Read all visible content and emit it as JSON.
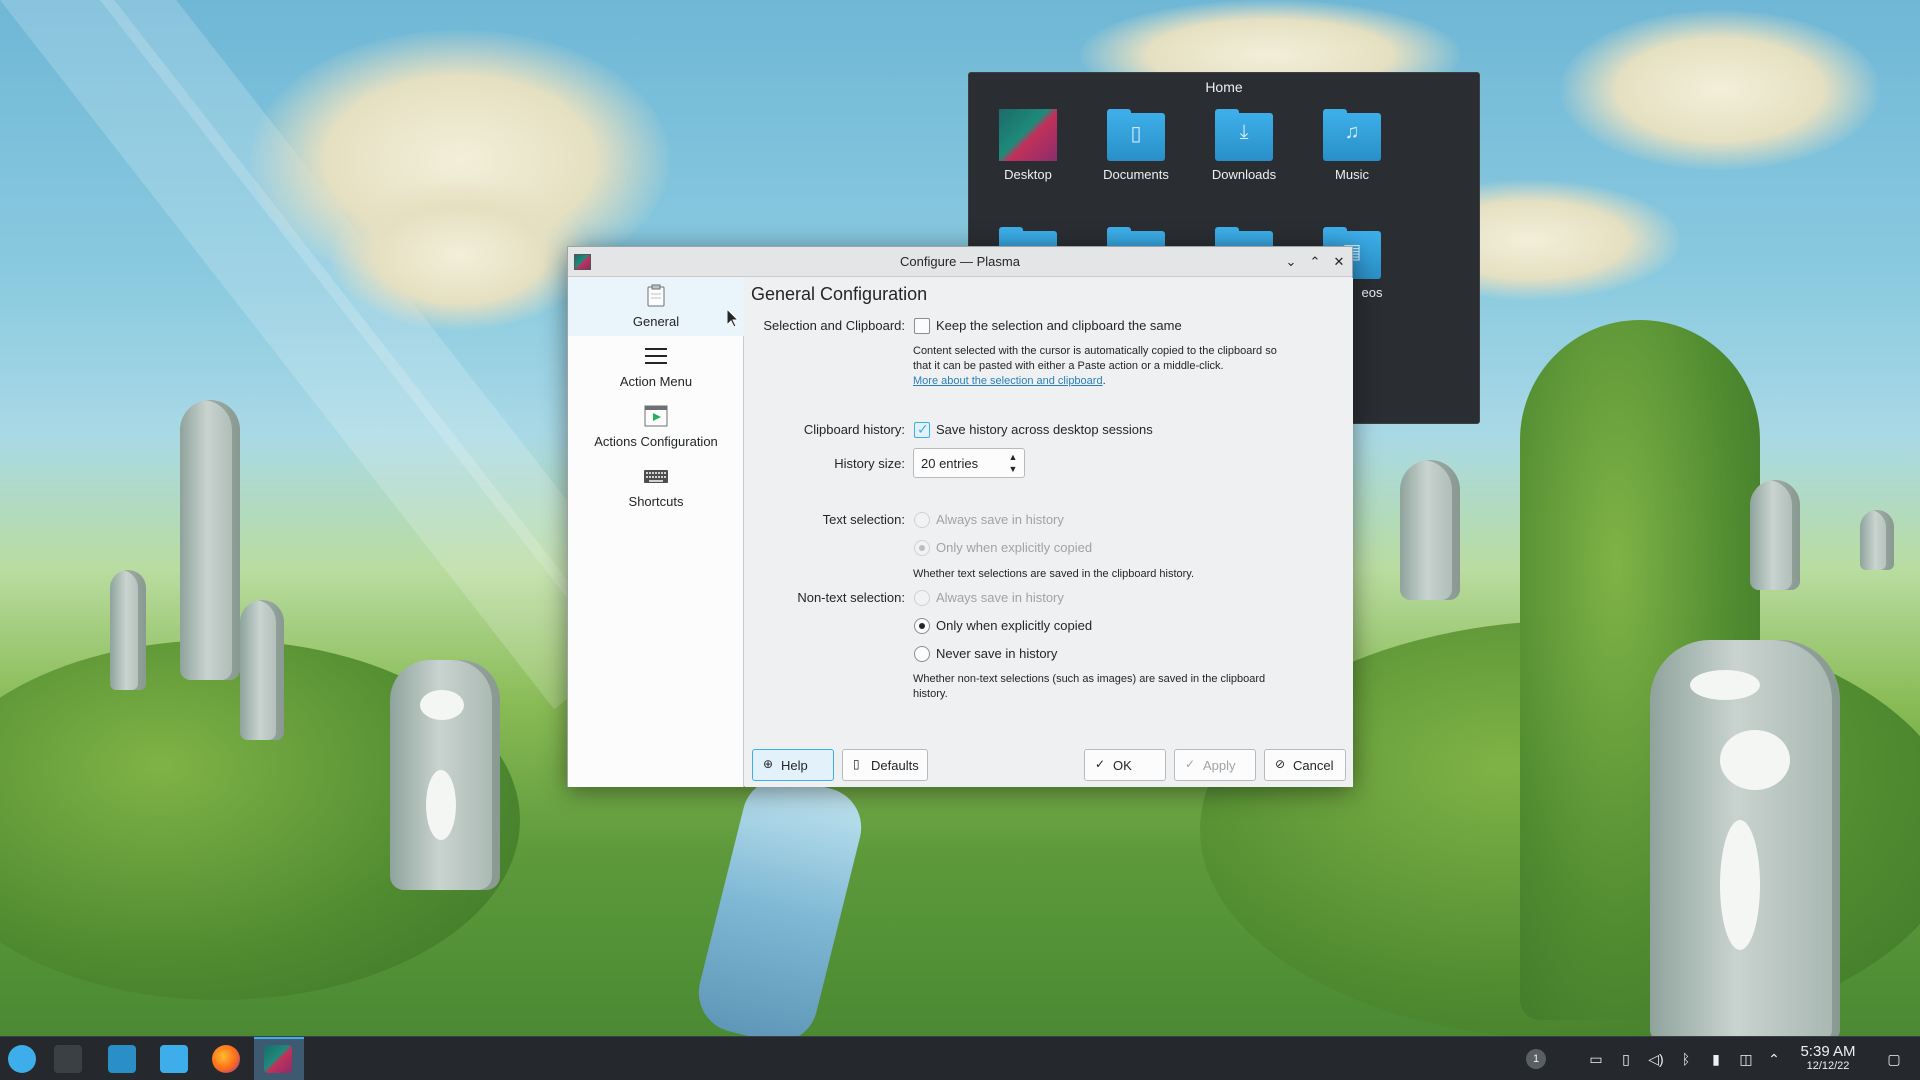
{
  "home_popup": {
    "title": "Home",
    "folders": [
      {
        "label": "Desktop",
        "icon": "desktop-folder-icon"
      },
      {
        "label": "Documents",
        "icon": "documents-folder-icon"
      },
      {
        "label": "Downloads",
        "icon": "downloads-folder-icon"
      },
      {
        "label": "Music",
        "icon": "music-folder-icon"
      }
    ],
    "partial_label": "eos"
  },
  "dialog": {
    "title": "Configure — Plasma",
    "sidebar": [
      {
        "label": "General",
        "icon": "clipboard-icon"
      },
      {
        "label": "Action Menu",
        "icon": "menu-icon"
      },
      {
        "label": "Actions Configuration",
        "icon": "actions-icon"
      },
      {
        "label": "Shortcuts",
        "icon": "keyboard-icon"
      }
    ],
    "page_title": "General Configuration",
    "selection_clipboard": {
      "label": "Selection and Clipboard:",
      "checkbox_label": "Keep the selection and clipboard the same",
      "checked": false,
      "help_line1": "Content selected with the cursor is automatically copied to the clipboard so",
      "help_line2": "that it can be pasted with either a Paste action or a middle-click.",
      "help_link": "More about the selection and clipboard",
      "help_link_tail": "."
    },
    "clipboard_history": {
      "label": "Clipboard history:",
      "checkbox_label": "Save history across desktop sessions",
      "checked": true
    },
    "history_size": {
      "label": "History size:",
      "value": "20 entries"
    },
    "text_selection": {
      "label": "Text selection:",
      "option_always": "Always save in history",
      "option_only": "Only when explicitly copied",
      "help": "Whether text selections are saved in the clipboard history."
    },
    "nontext_selection": {
      "label": "Non-text selection:",
      "option_always": "Always save in history",
      "option_only": "Only when explicitly copied",
      "option_never": "Never save in history",
      "help_line1": "Whether non-text selections (such as images) are saved in the clipboard",
      "help_line2": "history."
    },
    "buttons": {
      "help": "Help",
      "defaults": "Defaults",
      "ok": "OK",
      "apply": "Apply",
      "cancel": "Cancel"
    }
  },
  "taskbar": {
    "time": "5:39 AM",
    "date": "12/12/22",
    "notification_count": "1"
  },
  "colors": {
    "accent": "#3daee9",
    "link": "#2980b9",
    "taskbar_bg": "#25292d",
    "dialog_bg": "#eff0f1"
  }
}
